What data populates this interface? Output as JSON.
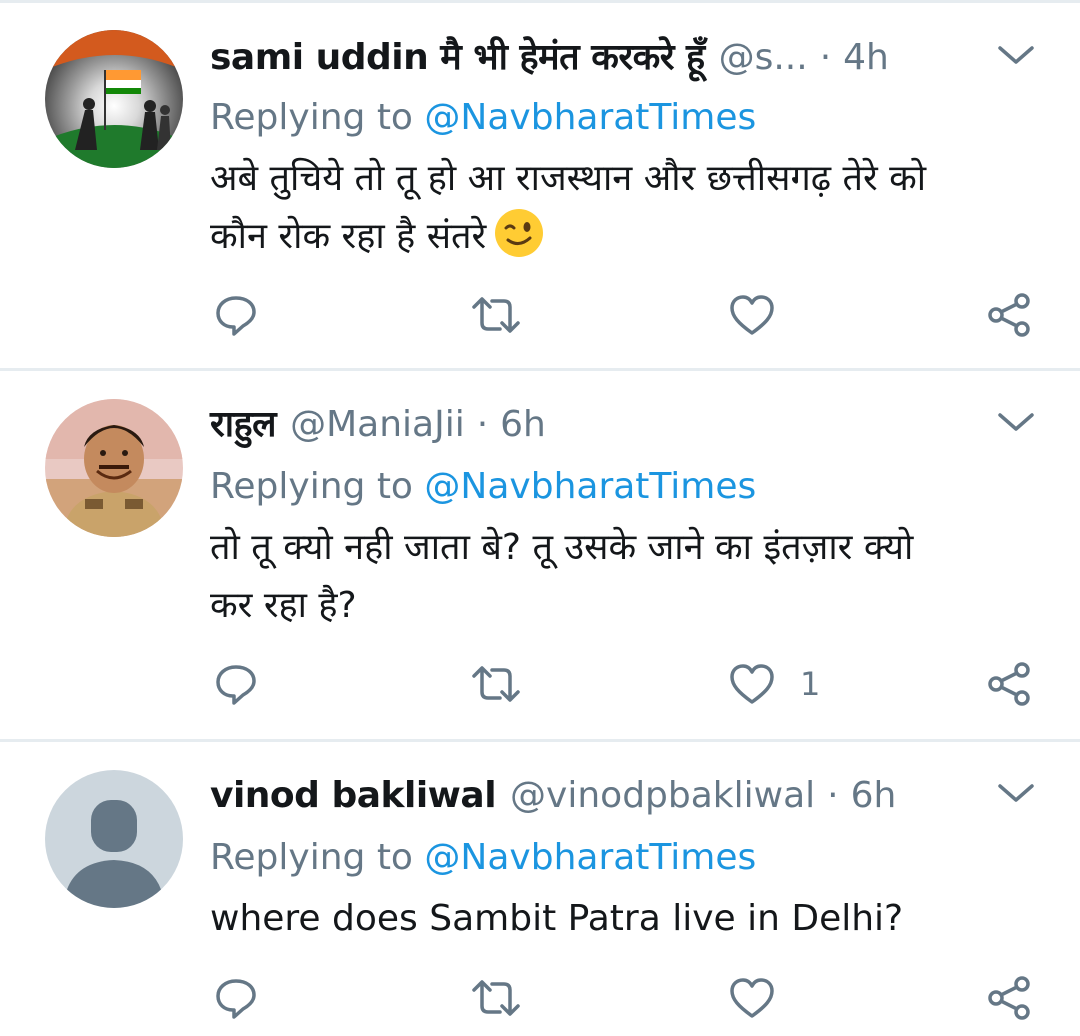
{
  "tweets": [
    {
      "display_name": "sami uddin मै भी हेमंत करकरे हूँ",
      "handle": "@s...",
      "separator": "·",
      "time": "4h",
      "reply_prefix": "Replying to",
      "reply_mention": "@NavbharatTimes",
      "text_line1": "अबे तुचिये तो तू हो आ राजस्थान और छत्तीसगढ़ तेरे को",
      "text_line2": "कौन रोक रहा है संतरे",
      "emoji": "winking-face-emoji",
      "avatar": "patriotic-flag-soldiers-avatar",
      "like_count": ""
    },
    {
      "display_name": "राहुल",
      "handle": "@ManiaJii",
      "separator": "·",
      "time": "6h",
      "reply_prefix": "Replying to",
      "reply_mention": "@NavbharatTimes",
      "text_line1": "तो तू क्यो नही जाता बे? तू उसके जाने का इंतज़ार क्यो",
      "text_line2": "कर रहा है?",
      "avatar": "man-in-uniform-avatar",
      "like_count": "1"
    },
    {
      "display_name": "vinod bakliwal",
      "handle": "@vinodpbakliwal",
      "separator": "·",
      "time": "6h",
      "reply_prefix": "Replying to",
      "reply_mention": "@NavbharatTimes",
      "text_line1": "where does Sambit Patra live in Delhi?",
      "avatar": "default-profile-avatar",
      "like_count": ""
    }
  ],
  "colors": {
    "text": "#14171a",
    "secondary": "#657786",
    "link": "#1b95e0",
    "divider": "#e6ecf0",
    "icon": "#657786"
  },
  "icons": [
    "reply-icon",
    "retweet-icon",
    "like-icon",
    "share-icon",
    "chevron-down-icon"
  ]
}
